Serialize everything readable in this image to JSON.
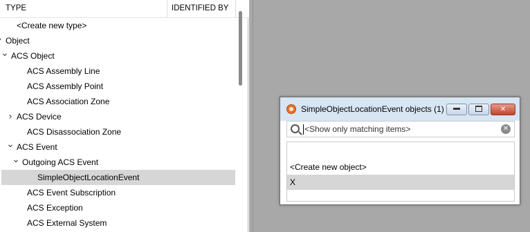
{
  "columns": {
    "type": "TYPE",
    "identified_by": "IDENTIFIED BY"
  },
  "tree": [
    {
      "label": "<Create new type>",
      "expander": "",
      "selected": false
    },
    {
      "label": "Object",
      "expander": "expanded",
      "selected": false
    },
    {
      "label": "ACS Object",
      "expander": "expanded",
      "selected": false
    },
    {
      "label": "ACS Assembly Line",
      "expander": "",
      "selected": false
    },
    {
      "label": "ACS Assembly Point",
      "expander": "",
      "selected": false
    },
    {
      "label": "ACS Association Zone",
      "expander": "",
      "selected": false
    },
    {
      "label": "ACS Device",
      "expander": "collapsed",
      "selected": false
    },
    {
      "label": "ACS Disassociation Zone",
      "expander": "",
      "selected": false
    },
    {
      "label": "ACS Event",
      "expander": "expanded",
      "selected": false
    },
    {
      "label": "Outgoing ACS Event",
      "expander": "expanded",
      "selected": false
    },
    {
      "label": "SimpleObjectLocationEvent",
      "expander": "",
      "selected": true
    },
    {
      "label": "ACS Event Subscription",
      "expander": "",
      "selected": false
    },
    {
      "label": "ACS Exception",
      "expander": "",
      "selected": false
    },
    {
      "label": "ACS External System",
      "expander": "",
      "selected": false
    }
  ],
  "dialog": {
    "title": "SimpleObjectLocationEvent objects (1)",
    "search_placeholder": "<Show only matching items>",
    "list": [
      {
        "label": "<Create new object>",
        "selected": false
      },
      {
        "label": "X",
        "selected": true
      }
    ]
  }
}
